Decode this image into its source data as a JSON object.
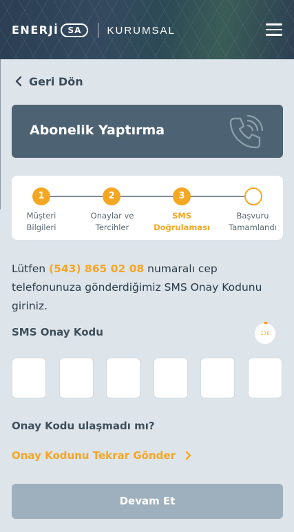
{
  "header": {
    "brand_word": "ENERJİ",
    "brand_badge": "SA",
    "brand_sub": "KURUMSAL",
    "menu_icon": "hamburger-menu-icon"
  },
  "back": {
    "label": "Geri Dön",
    "icon": "chevron-left-icon"
  },
  "title_card": {
    "title": "Abonelik Yaptırma",
    "icon": "phone-ringing-icon"
  },
  "stepper": {
    "accent_color": "#f5a623",
    "steps": [
      {
        "number": "1",
        "label_line1": "Müşteri",
        "label_line2": "Bilgileri",
        "state": "done"
      },
      {
        "number": "2",
        "label_line1": "Onaylar ve",
        "label_line2": "Tercihler",
        "state": "done"
      },
      {
        "number": "3",
        "label_line1": "SMS",
        "label_line2": "Doğrulaması",
        "state": "active"
      },
      {
        "number": "",
        "label_line1": "Başvuru",
        "label_line2": "Tamamlandı",
        "state": "todo"
      }
    ]
  },
  "instruction": {
    "prefix": "Lütfen ",
    "phone": "(543) 865 02 08",
    "suffix": " numaralı cep telefonunuza gönderdiğimiz SMS Onay Kodunu giriniz."
  },
  "sms": {
    "label": "SMS Onay Kodu",
    "timer": "176",
    "code_digits": [
      "",
      "",
      "",
      "",
      "",
      ""
    ]
  },
  "resend": {
    "question": "Onay Kodu ulaşmadı mı?",
    "link": "Onay Kodunu Tekrar Gönder",
    "icon": "chevron-right-icon"
  },
  "continue_button": {
    "label": "Devam Et",
    "color": "#9eb0bd"
  }
}
